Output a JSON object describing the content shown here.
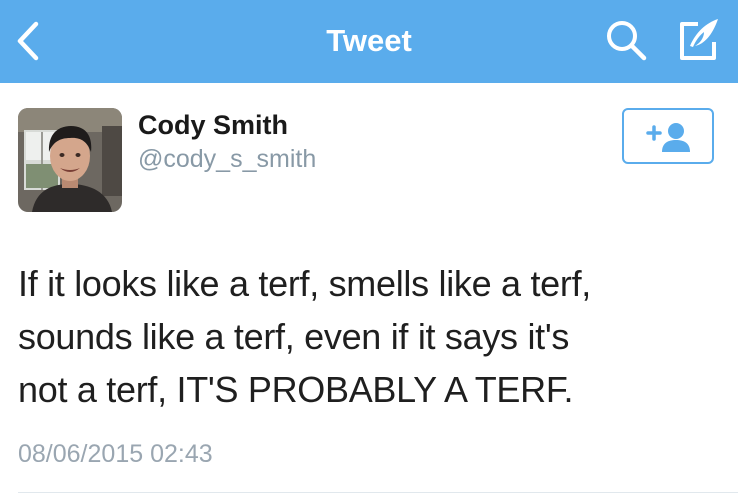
{
  "nav": {
    "title": "Tweet",
    "back_icon": "chevron-left-icon",
    "search_icon": "search-icon",
    "compose_icon": "compose-tweet-icon",
    "bar_color": "#5aacec"
  },
  "user": {
    "name": "Cody Smith",
    "handle": "@cody_s_smith",
    "avatar_icon": "profile-photo"
  },
  "follow_button": {
    "icon": "follow-user-icon",
    "label": "+"
  },
  "tweet": {
    "lines": [
      "If it looks like a terf, smells like a terf,",
      "sounds like a terf, even if it says it's",
      "not a terf, IT'S PROBABLY A TERF."
    ],
    "timestamp": "08/06/2015 02:43"
  }
}
